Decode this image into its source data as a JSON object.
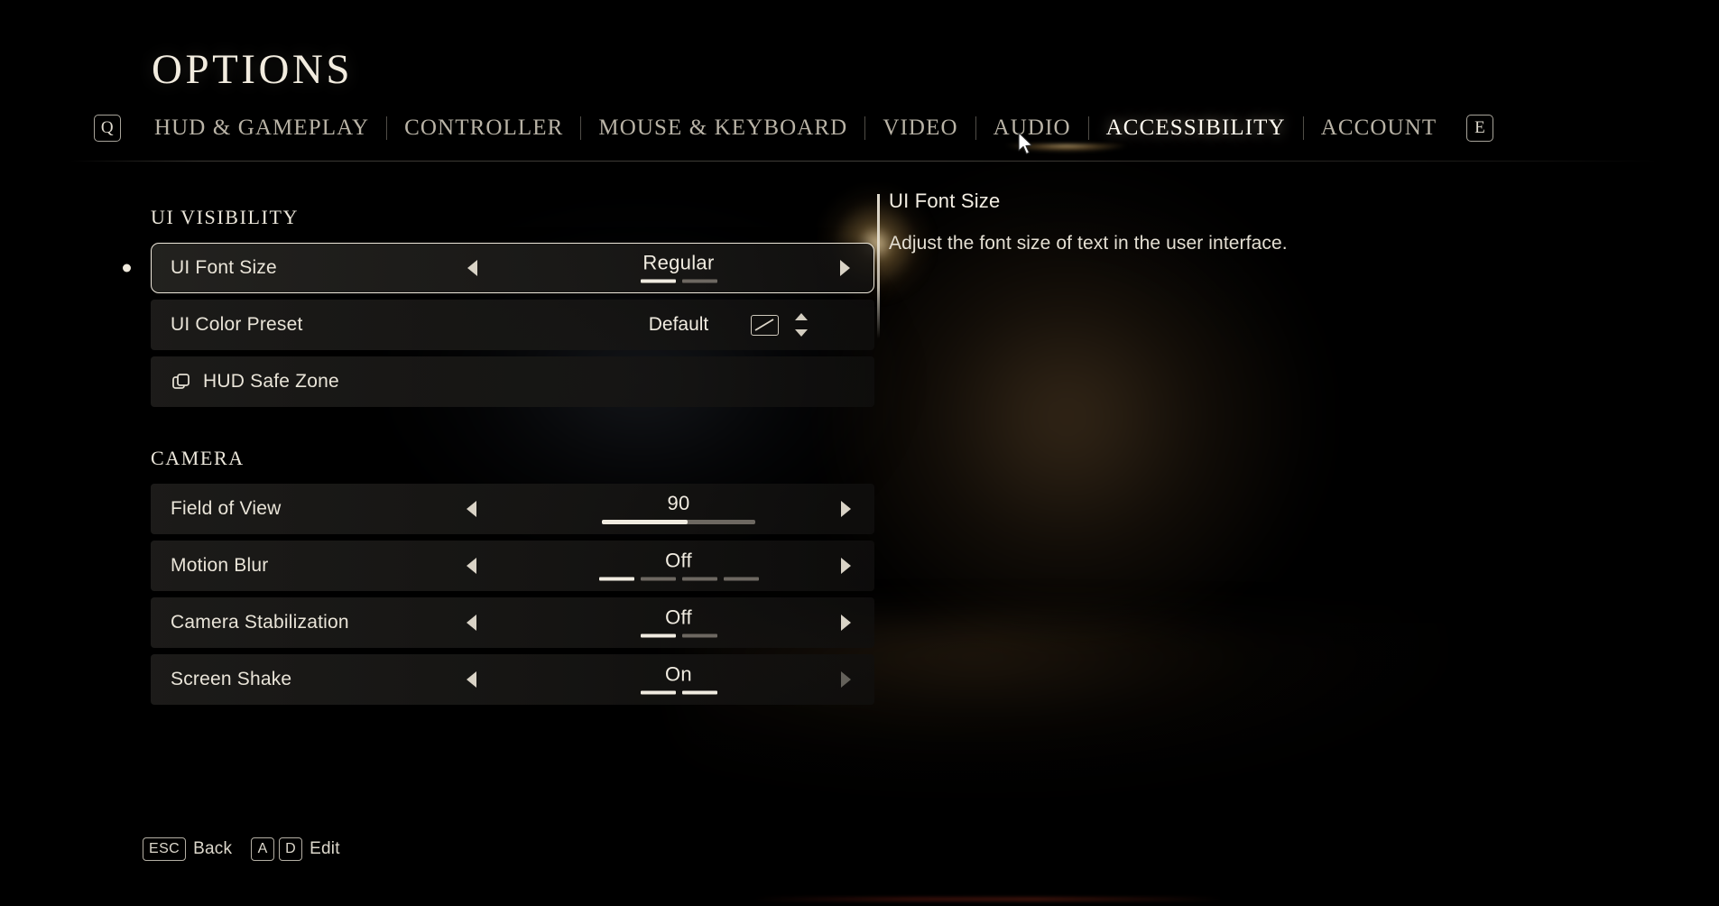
{
  "header": {
    "title": "OPTIONS",
    "left_key": "Q",
    "right_key": "E",
    "tabs": [
      {
        "label": "HUD & GAMEPLAY",
        "active": false
      },
      {
        "label": "CONTROLLER",
        "active": false
      },
      {
        "label": "MOUSE & KEYBOARD",
        "active": false
      },
      {
        "label": "VIDEO",
        "active": false
      },
      {
        "label": "AUDIO",
        "active": false
      },
      {
        "label": "ACCESSIBILITY",
        "active": true
      },
      {
        "label": "ACCOUNT",
        "active": false
      }
    ]
  },
  "groups": [
    {
      "title": "UI VISIBILITY",
      "rows": [
        {
          "label": "UI Font Size",
          "value": "Regular",
          "control": "stepper",
          "selected": true,
          "segments_total": 2,
          "segments_on": 1,
          "left_arrow": true,
          "right_arrow": true
        },
        {
          "label": "UI Color Preset",
          "value": "Default",
          "control": "preset",
          "selected": false,
          "swatch_icon": "diagonal-slash-swatch",
          "stepper_icon": "up-down-chevron"
        },
        {
          "label": "HUD Safe Zone",
          "value": "",
          "control": "submenu",
          "selected": false,
          "icon": "layers-icon"
        }
      ]
    },
    {
      "title": "CAMERA",
      "rows": [
        {
          "label": "Field of View",
          "value": "90",
          "control": "slider",
          "selected": false,
          "fill_percent": 56,
          "left_arrow": true,
          "right_arrow": true
        },
        {
          "label": "Motion Blur",
          "value": "Off",
          "control": "stepper",
          "selected": false,
          "segments_total": 4,
          "segments_on": 1,
          "left_arrow": true,
          "right_arrow": true
        },
        {
          "label": "Camera Stabilization",
          "value": "Off",
          "control": "stepper",
          "selected": false,
          "segments_total": 2,
          "segments_on": 1,
          "left_arrow": true,
          "right_arrow": true
        },
        {
          "label": "Screen Shake",
          "value": "On",
          "control": "stepper",
          "selected": false,
          "segments_total": 2,
          "segments_on": 2,
          "left_arrow": true,
          "right_arrow": false
        }
      ]
    }
  ],
  "description": {
    "title": "UI Font Size",
    "body": "Adjust the font size of text in the user interface."
  },
  "footer": {
    "back_key": "ESC",
    "back_label": "Back",
    "edit_key_left": "A",
    "edit_key_right": "D",
    "edit_label": "Edit"
  },
  "colors": {
    "accent": "#f0ebe0",
    "text": "#e8e4da",
    "muted": "#6d6861",
    "tab_active": "#fffaf0",
    "underline_glow": "#f8d696"
  }
}
